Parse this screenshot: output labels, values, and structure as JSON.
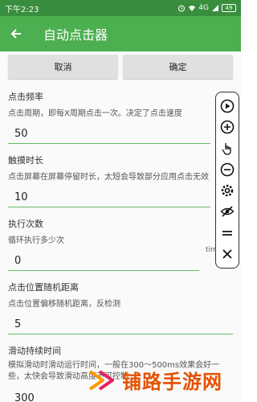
{
  "status_bar": {
    "time": "下午2:23",
    "network": "4G",
    "battery": "49"
  },
  "app_bar": {
    "title": "自动点击器"
  },
  "actions": {
    "cancel_label": "取消",
    "confirm_label": "确定"
  },
  "sections": [
    {
      "title": "点击频率",
      "desc": "点击周期，即每X周期点击一次。决定了点击速度",
      "value": "50",
      "unit": "Ms"
    },
    {
      "title": "触摸时长",
      "desc": "点击屏幕在屏幕停留时长，太短会导致部分应用点击无效",
      "value": "10",
      "unit": "Ms"
    },
    {
      "title": "执行次数",
      "desc": "循环执行多少次",
      "value": "0",
      "unit": "times"
    },
    {
      "title": "点击位置随机距离",
      "desc": "点击位置偏移随机距离，反检测",
      "value": "5",
      "unit": ""
    },
    {
      "title": "滑动持续时间",
      "desc": "模拟滑动时滑动运行时间，一般在300～500ms效果会好一些，太快会导致滑动高度不可控制",
      "value": "300",
      "unit": ""
    }
  ],
  "toolbar": [
    "play-icon",
    "add-icon",
    "tap-gesture-icon",
    "remove-icon",
    "settings-icon",
    "hide-icon",
    "drag-handle-icon",
    "close-icon"
  ],
  "watermark": {
    "text": "铺路手游网"
  },
  "colors": {
    "primary": "#4caf50",
    "primary_dark": "#388e3c",
    "accent_line": "#66bb6a",
    "watermark": "#e65100"
  }
}
